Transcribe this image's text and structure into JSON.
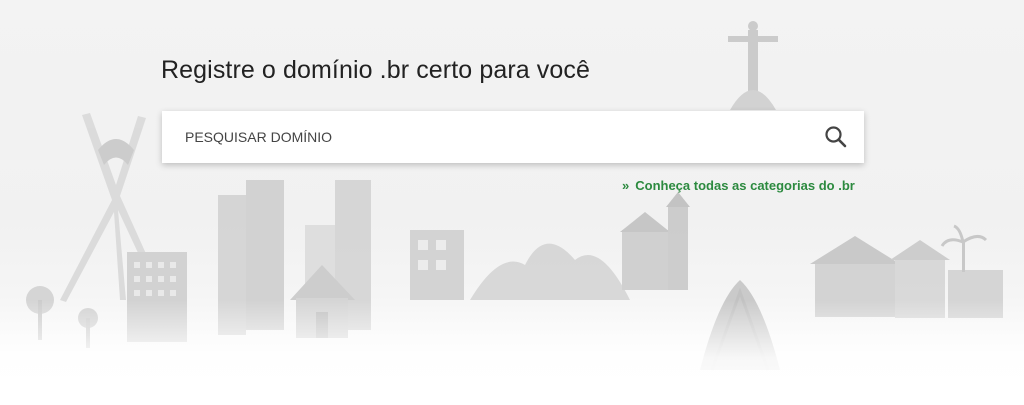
{
  "hero": {
    "headline": "Registre o domínio .br certo para você",
    "search": {
      "placeholder": "PESQUISAR DOMÍNIO",
      "value": "",
      "button_icon": "search-icon"
    },
    "categories_link": {
      "arrows": "»",
      "label": "Conheça todas as categorias do .br"
    }
  },
  "colors": {
    "link_green": "#2c8a3f",
    "background": "#f3f3f3",
    "text": "#222222"
  }
}
